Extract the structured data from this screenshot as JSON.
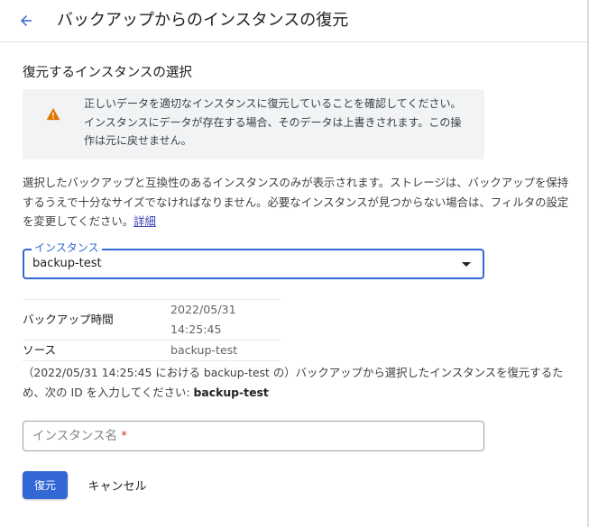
{
  "header": {
    "back_icon": "arrow-back-icon",
    "title": "バックアップからのインスタンスの復元"
  },
  "section": {
    "title": "復元するインスタンスの選択"
  },
  "warning": {
    "icon": "warning-icon",
    "icon_color": "#e37400",
    "text": "正しいデータを適切なインスタンスに復元していることを確認してください。インスタンスにデータが存在する場合、そのデータは上書きされます。この操作は元に戻せません。"
  },
  "description": {
    "text": "選択したバックアップと互換性のあるインスタンスのみが表示されます。ストレージは、バックアップを保持するうえで十分なサイズでなければなりません。必要なインスタンスが見つからない場合は、フィルタの設定を変更してください。",
    "link": "詳細"
  },
  "instance_select": {
    "label": "インスタンス",
    "value": "backup-test",
    "caret_icon": "dropdown-caret-icon"
  },
  "backup_info": {
    "rows": [
      {
        "key": "バックアップ時間",
        "value": "2022/05/31 14:25:45"
      },
      {
        "key": "ソース",
        "value": "backup-test"
      }
    ]
  },
  "confirm": {
    "text": "（2022/05/31 14:25:45 における backup-test の）バックアップから選択したインスタンスを復元するため、次の ID を入力してください: ",
    "id": "backup-test"
  },
  "instance_name_input": {
    "placeholder": "インスタンス名",
    "required_mark": "*",
    "value": ""
  },
  "actions": {
    "restore_label": "復元",
    "cancel_label": "キャンセル"
  },
  "colors": {
    "accent": "#3367d6",
    "link": "#3c3fb8",
    "warning_bg": "#f1f3f4",
    "required": "#d93025"
  }
}
